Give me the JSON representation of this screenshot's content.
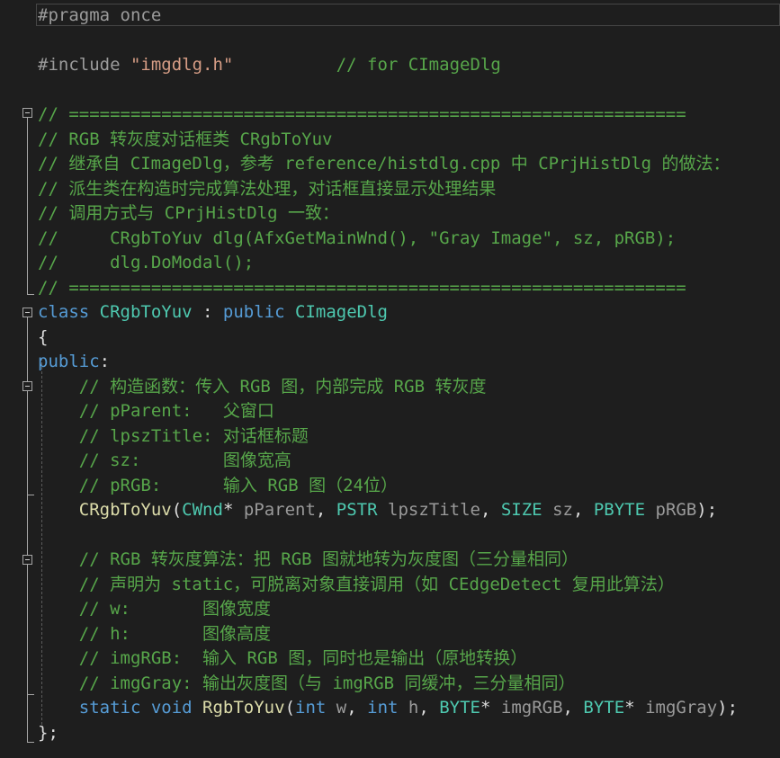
{
  "editor": {
    "lines": [
      {
        "tokens": [
          {
            "t": "#pragma once",
            "c": "c-pre"
          }
        ]
      },
      {
        "tokens": []
      },
      {
        "tokens": [
          {
            "t": "#include ",
            "c": "c-pre"
          },
          {
            "t": "\"imgdlg.h\"",
            "c": "c-str"
          },
          {
            "t": "          ",
            "c": "c-txt"
          },
          {
            "t": "// for CImageDlg",
            "c": "c-cm"
          }
        ]
      },
      {
        "tokens": []
      },
      {
        "tokens": [
          {
            "t": "// ============================================================",
            "c": "c-cm"
          }
        ]
      },
      {
        "tokens": [
          {
            "t": "// RGB 转灰度对话框类 CRgbToYuv",
            "c": "c-cm"
          }
        ]
      },
      {
        "tokens": [
          {
            "t": "// 继承自 CImageDlg，参考 reference/histdlg.cpp 中 CPrjHistDlg 的做法：",
            "c": "c-cm"
          }
        ]
      },
      {
        "tokens": [
          {
            "t": "// 派生类在构造时完成算法处理，对话框直接显示处理结果",
            "c": "c-cm"
          }
        ]
      },
      {
        "tokens": [
          {
            "t": "// 调用方式与 CPrjHistDlg 一致：",
            "c": "c-cm"
          }
        ]
      },
      {
        "tokens": [
          {
            "t": "//     CRgbToYuv dlg(AfxGetMainWnd(), \"Gray Image\", sz, pRGB);",
            "c": "c-cm"
          }
        ]
      },
      {
        "tokens": [
          {
            "t": "//     dlg.DoModal();",
            "c": "c-cm"
          }
        ]
      },
      {
        "tokens": [
          {
            "t": "// ============================================================",
            "c": "c-cm"
          }
        ]
      },
      {
        "tokens": [
          {
            "t": "class ",
            "c": "c-kw"
          },
          {
            "t": "CRgbToYuv",
            "c": "c-type"
          },
          {
            "t": " : ",
            "c": "c-txt"
          },
          {
            "t": "public ",
            "c": "c-kw"
          },
          {
            "t": "CImageDlg",
            "c": "c-type"
          }
        ]
      },
      {
        "tokens": [
          {
            "t": "{",
            "c": "c-txt"
          }
        ]
      },
      {
        "tokens": [
          {
            "t": "public",
            "c": "c-kw"
          },
          {
            "t": ":",
            "c": "c-txt"
          }
        ]
      },
      {
        "tokens": [
          {
            "t": "    ",
            "c": "c-txt"
          },
          {
            "t": "// 构造函数：传入 RGB 图，内部完成 RGB 转灰度",
            "c": "c-cm"
          }
        ]
      },
      {
        "tokens": [
          {
            "t": "    ",
            "c": "c-txt"
          },
          {
            "t": "// pParent:   父窗口",
            "c": "c-cm"
          }
        ]
      },
      {
        "tokens": [
          {
            "t": "    ",
            "c": "c-txt"
          },
          {
            "t": "// lpszTitle: 对话框标题",
            "c": "c-cm"
          }
        ]
      },
      {
        "tokens": [
          {
            "t": "    ",
            "c": "c-txt"
          },
          {
            "t": "// sz:        图像宽高",
            "c": "c-cm"
          }
        ]
      },
      {
        "tokens": [
          {
            "t": "    ",
            "c": "c-txt"
          },
          {
            "t": "// pRGB:      输入 RGB 图（24位）",
            "c": "c-cm"
          }
        ]
      },
      {
        "tokens": [
          {
            "t": "    ",
            "c": "c-txt"
          },
          {
            "t": "CRgbToYuv",
            "c": "c-fn"
          },
          {
            "t": "(",
            "c": "c-txt"
          },
          {
            "t": "CWnd",
            "c": "c-type"
          },
          {
            "t": "* ",
            "c": "c-txt"
          },
          {
            "t": "pParent",
            "c": "c-param"
          },
          {
            "t": ", ",
            "c": "c-txt"
          },
          {
            "t": "PSTR",
            "c": "c-type"
          },
          {
            "t": " ",
            "c": "c-txt"
          },
          {
            "t": "lpszTitle",
            "c": "c-param"
          },
          {
            "t": ", ",
            "c": "c-txt"
          },
          {
            "t": "SIZE",
            "c": "c-type"
          },
          {
            "t": " ",
            "c": "c-txt"
          },
          {
            "t": "sz",
            "c": "c-param"
          },
          {
            "t": ", ",
            "c": "c-txt"
          },
          {
            "t": "PBYTE",
            "c": "c-type"
          },
          {
            "t": " ",
            "c": "c-txt"
          },
          {
            "t": "pRGB",
            "c": "c-param"
          },
          {
            "t": ");",
            "c": "c-txt"
          }
        ]
      },
      {
        "tokens": []
      },
      {
        "tokens": [
          {
            "t": "    ",
            "c": "c-txt"
          },
          {
            "t": "// RGB 转灰度算法：把 RGB 图就地转为灰度图（三分量相同）",
            "c": "c-cm"
          }
        ]
      },
      {
        "tokens": [
          {
            "t": "    ",
            "c": "c-txt"
          },
          {
            "t": "// 声明为 static，可脱离对象直接调用（如 CEdgeDetect 复用此算法）",
            "c": "c-cm"
          }
        ]
      },
      {
        "tokens": [
          {
            "t": "    ",
            "c": "c-txt"
          },
          {
            "t": "// w:       图像宽度",
            "c": "c-cm"
          }
        ]
      },
      {
        "tokens": [
          {
            "t": "    ",
            "c": "c-txt"
          },
          {
            "t": "// h:       图像高度",
            "c": "c-cm"
          }
        ]
      },
      {
        "tokens": [
          {
            "t": "    ",
            "c": "c-txt"
          },
          {
            "t": "// imgRGB:  输入 RGB 图，同时也是输出（原地转换）",
            "c": "c-cm"
          }
        ]
      },
      {
        "tokens": [
          {
            "t": "    ",
            "c": "c-txt"
          },
          {
            "t": "// imgGray: 输出灰度图（与 imgRGB 同缓冲，三分量相同）",
            "c": "c-cm"
          }
        ]
      },
      {
        "tokens": [
          {
            "t": "    ",
            "c": "c-txt"
          },
          {
            "t": "static ",
            "c": "c-kw"
          },
          {
            "t": "void ",
            "c": "c-kw"
          },
          {
            "t": "RgbToYuv",
            "c": "c-fn"
          },
          {
            "t": "(",
            "c": "c-txt"
          },
          {
            "t": "int ",
            "c": "c-kw"
          },
          {
            "t": "w",
            "c": "c-param"
          },
          {
            "t": ", ",
            "c": "c-txt"
          },
          {
            "t": "int ",
            "c": "c-kw"
          },
          {
            "t": "h",
            "c": "c-param"
          },
          {
            "t": ", ",
            "c": "c-txt"
          },
          {
            "t": "BYTE",
            "c": "c-type"
          },
          {
            "t": "* ",
            "c": "c-txt"
          },
          {
            "t": "imgRGB",
            "c": "c-param"
          },
          {
            "t": ", ",
            "c": "c-txt"
          },
          {
            "t": "BYTE",
            "c": "c-type"
          },
          {
            "t": "* ",
            "c": "c-txt"
          },
          {
            "t": "imgGray",
            "c": "c-param"
          },
          {
            "t": ");",
            "c": "c-txt"
          }
        ]
      },
      {
        "tokens": [
          {
            "t": "};",
            "c": "c-txt"
          }
        ]
      }
    ]
  }
}
